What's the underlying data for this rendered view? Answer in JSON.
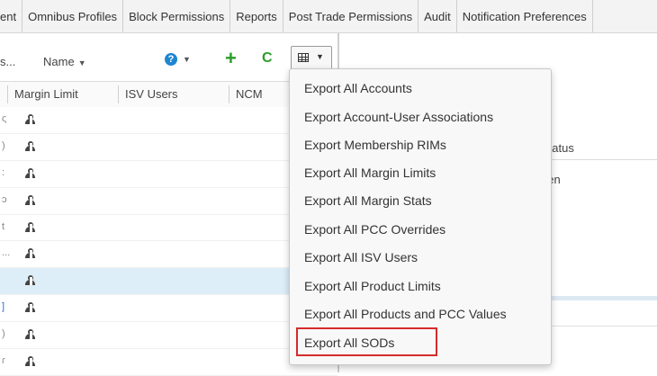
{
  "tabs": [
    {
      "label": "ent",
      "clipped": true
    },
    {
      "label": "Omnibus Profiles"
    },
    {
      "label": "Block Permissions"
    },
    {
      "label": "Reports"
    },
    {
      "label": "Post Trade Permissions"
    },
    {
      "label": "Audit"
    },
    {
      "label": "Notification Preferences"
    }
  ],
  "toolbar": {
    "search_clip": "s...",
    "sort_label": "Name",
    "help_symbol": "?",
    "add_symbol": "+",
    "refresh_symbol": "C"
  },
  "columns": {
    "margin_limit": "Margin Limit",
    "isv_users": "ISV Users",
    "ncm": "NCM"
  },
  "rows": [
    {
      "edge": "ς"
    },
    {
      "edge": ")"
    },
    {
      "edge": ":"
    },
    {
      "edge": "ɔ"
    },
    {
      "edge": "t"
    },
    {
      "edge": "..."
    },
    {
      "edge": ""
    },
    {
      "edge": "]"
    },
    {
      "edge": ")"
    },
    {
      "edge": "ɾ"
    }
  ],
  "right_panel": {
    "status_header": "Status",
    "status_value": "pen"
  },
  "export_menu": {
    "items": [
      "Export All Accounts",
      "Export Account-User Associations",
      "Export Membership RIMs",
      "Export All Margin Limits",
      "Export All Margin Stats",
      "Export All PCC Overrides",
      "Export All ISV Users",
      "Export All Product Limits",
      "Export All Products and PCC Values",
      "Export All SODs"
    ],
    "highlighted_item": "Export All SODs"
  },
  "colors": {
    "highlight_border": "#d52b2b",
    "selected_row": "#ddeef8",
    "add_icon": "#2a9d2a",
    "help_icon": "#1e86d1"
  }
}
